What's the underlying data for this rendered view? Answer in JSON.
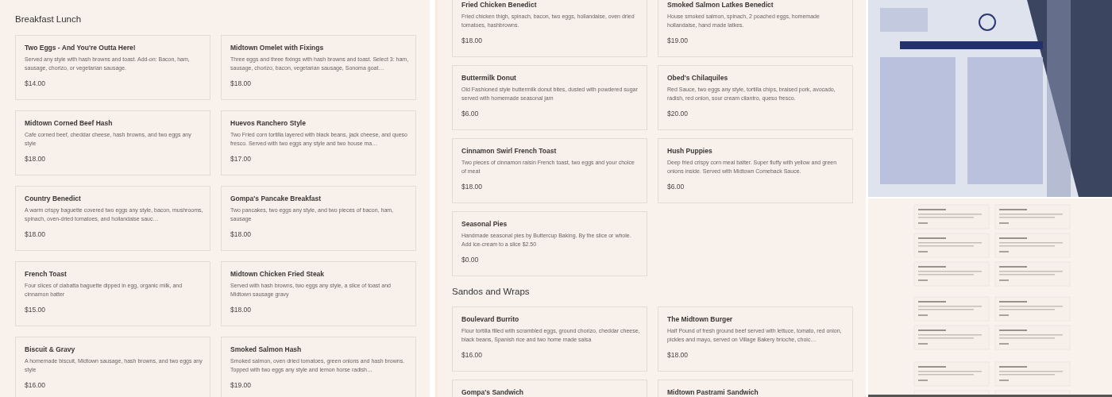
{
  "panels": [
    {
      "kind": "menu",
      "sections": [
        {
          "heading": "Breakfast Lunch",
          "items": [
            {
              "title": "Two Eggs - And You're Outta Here!",
              "description": "Served any style with hash browns and toast. Add-on: Bacon, ham, sausage, chorizo, or vegetarian sausage.",
              "price": "$14.00"
            },
            {
              "title": "Midtown Omelet with Fixings",
              "description": "Three eggs and three fixings with hash browns and toast. Select 3: ham, sausage, chorizo, bacon, vegetarian sausage, Sonoma goat…",
              "price": "$18.00"
            },
            {
              "title": "Midtown Corned Beef Hash",
              "description": "Cafe corned beef, cheddar cheese, hash browns, and two eggs any style",
              "price": "$18.00"
            },
            {
              "title": "Huevos Ranchero Style",
              "description": "Two Fried corn tortilla layered with black beans, jack cheese, and queso fresco. Served with two eggs any style and two house ma…",
              "price": "$17.00"
            },
            {
              "title": "Country Benedict",
              "description": "A warm crispy baguette covered two eggs any style, bacon, mushrooms, spinach, oven-dried tomatoes, and hollandaise sauc…",
              "price": "$18.00"
            },
            {
              "title": "Gompa's Pancake Breakfast",
              "description": "Two pancakes, two eggs any style, and two pieces of bacon, ham, sausage",
              "price": "$18.00"
            },
            {
              "title": "French Toast",
              "description": "Four slices of ciabatta baguette dipped in egg, organic milk, and cinnamon batter",
              "price": "$15.00"
            },
            {
              "title": "Midtown Chicken Fried Steak",
              "description": "Served with hash browns, two eggs any style, a slice of toast and Midtown sausage gravy",
              "price": "$18.00"
            },
            {
              "title": "Biscuit & Gravy",
              "description": "A homemade biscuit, Midtown sausage, hash browns, and two eggs any style",
              "price": "$16.00"
            },
            {
              "title": "Smoked Salmon Hash",
              "description": "Smoked salmon, oven dried tomatoes, green onions and hash browns. Topped with two eggs any style and lemon horse radish…",
              "price": "$19.00"
            }
          ]
        }
      ]
    },
    {
      "kind": "menu",
      "sections": [
        {
          "items": [
            {
              "title": "Fried Chicken Benedict",
              "description": "Fried chicken thigh, spinach, bacon, two eggs, hollandaise, oven dried tomatoes, hashbrowns.",
              "price": "$18.00"
            },
            {
              "title": "Smoked Salmon Latkes Benedict",
              "description": "House smoked salmon, spinach, 2 poached eggs, homemade hollandaise, hand made latkes.",
              "price": "$19.00"
            },
            {
              "title": "Buttermilk Donut",
              "description": "Old Fashioned style buttermilk donut bites, dusted with powdered sugar served with homemade seasonal jam",
              "price": "$6.00"
            },
            {
              "title": "Obed's Chilaquiles",
              "description": "Red Sauce, two eggs any style, tortilla chips, braised pork, avocado, radish, red onion, sour cream cilantro, queso fresco.",
              "price": "$20.00"
            },
            {
              "title": "Cinnamon Swirl French Toast",
              "description": "Two pieces of cinnamon raisin French toast, two eggs and your choice of meat",
              "price": "$18.00"
            },
            {
              "title": "Hush Puppies",
              "description": "Deep fried crispy corn meal batter. Super fluffy with yellow and green onions inside. Served with Midtown Comeback Sauce.",
              "price": "$6.00"
            },
            {
              "title": "Seasonal Pies",
              "description": "Handmade seasonal pies by Buttercup Baking. By the slice or whole. Add ice-cream to a slice $2.50",
              "price": "$0.00"
            }
          ]
        },
        {
          "heading": "Sandos and Wraps",
          "items": [
            {
              "title": "Boulevard Burrito",
              "description": "Flour tortilla filled with scrambled eggs, ground chorizo, cheddar cheese, black beans, Spanish rice and two home made salsa",
              "price": "$16.00"
            },
            {
              "title": "The Midtown Burger",
              "description": "Half Pound of fresh ground beef served with lettuce, tomato, red onion, pickles and mayo, served on Village Bakery brioche, choic…",
              "price": "$18.00"
            },
            {
              "title": "Gompa's Sandwich"
            },
            {
              "title": "Midtown Pastrami Sandwich"
            }
          ]
        }
      ]
    }
  ],
  "side": [
    {
      "kind": "picture"
    },
    {
      "kind": "page-preview"
    }
  ]
}
